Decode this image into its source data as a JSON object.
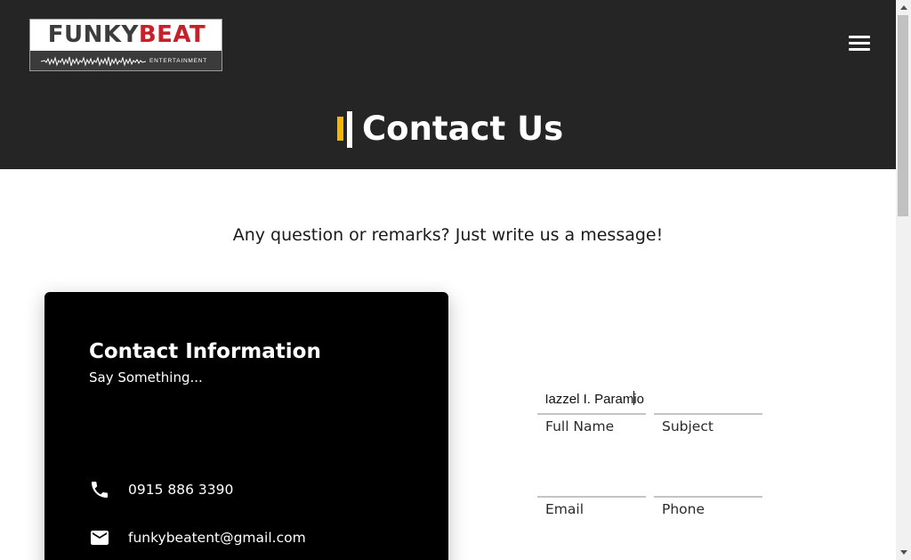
{
  "header": {
    "logo": {
      "word1": "FUNKY",
      "word2": "BEAT",
      "tagline": "ENTERTAINMENT",
      "colors": {
        "funky": "#3c3c3c",
        "beat": "#c8202a"
      }
    },
    "menu_icon": "hamburger-icon",
    "title": "Contact Us",
    "accent_color": "#f2b705",
    "background": "#252525"
  },
  "intro": {
    "text": "Any question or remarks? Just write us a message!"
  },
  "contact_card": {
    "title": "Contact Information",
    "subtitle": "Say Something...",
    "phone": {
      "icon": "phone-icon",
      "text": "0915 886 3390"
    },
    "email": {
      "icon": "mail-icon",
      "text": "funkybeatent@gmail.com"
    }
  },
  "form": {
    "full_name": {
      "label": "Full Name",
      "value": "Hazzel I. Paramio"
    },
    "subject": {
      "label": "Subject",
      "value": ""
    },
    "email": {
      "label": "Email",
      "value": ""
    },
    "phone": {
      "label": "Phone",
      "value": ""
    }
  }
}
